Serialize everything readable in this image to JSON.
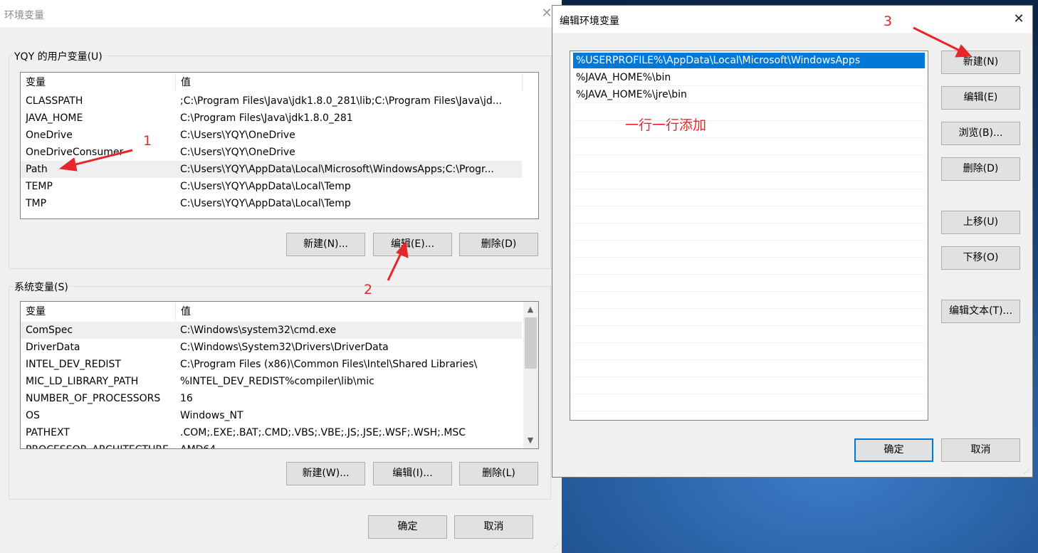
{
  "left_dialog": {
    "title": "环境变量",
    "user_group_label": "YQY 的用户变量(U)",
    "user_columns": [
      "变量",
      "值"
    ],
    "user_rows": [
      {
        "name": "CLASSPATH",
        "value": ";C:\\Program Files\\Java\\jdk1.8.0_281\\lib;C:\\Program Files\\Java\\jd..."
      },
      {
        "name": "JAVA_HOME",
        "value": "C:\\Program Files\\Java\\jdk1.8.0_281"
      },
      {
        "name": "OneDrive",
        "value": "C:\\Users\\YQY\\OneDrive"
      },
      {
        "name": "OneDriveConsumer",
        "value": "C:\\Users\\YQY\\OneDrive"
      },
      {
        "name": "Path",
        "value": "C:\\Users\\YQY\\AppData\\Local\\Microsoft\\WindowsApps;C:\\Progr..."
      },
      {
        "name": "TEMP",
        "value": "C:\\Users\\YQY\\AppData\\Local\\Temp"
      },
      {
        "name": "TMP",
        "value": "C:\\Users\\YQY\\AppData\\Local\\Temp"
      }
    ],
    "user_buttons": {
      "new": "新建(N)...",
      "edit": "编辑(E)...",
      "delete": "删除(D)"
    },
    "system_group_label": "系统变量(S)",
    "system_columns": [
      "变量",
      "值"
    ],
    "system_rows": [
      {
        "name": "ComSpec",
        "value": "C:\\Windows\\system32\\cmd.exe"
      },
      {
        "name": "DriverData",
        "value": "C:\\Windows\\System32\\Drivers\\DriverData"
      },
      {
        "name": "INTEL_DEV_REDIST",
        "value": "C:\\Program Files (x86)\\Common Files\\Intel\\Shared Libraries\\"
      },
      {
        "name": "MIC_LD_LIBRARY_PATH",
        "value": "%INTEL_DEV_REDIST%compiler\\lib\\mic"
      },
      {
        "name": "NUMBER_OF_PROCESSORS",
        "value": "16"
      },
      {
        "name": "OS",
        "value": "Windows_NT"
      },
      {
        "name": "PATHEXT",
        "value": ".COM;.EXE;.BAT;.CMD;.VBS;.VBE;.JS;.JSE;.WSF;.WSH;.MSC"
      },
      {
        "name": "PROCESSOR_ARCHITECTURE",
        "value": "AMD64"
      }
    ],
    "system_buttons": {
      "new": "新建(W)...",
      "edit": "编辑(I)...",
      "delete": "删除(L)"
    },
    "ok": "确定",
    "cancel": "取消"
  },
  "right_dialog": {
    "title": "编辑环境变量",
    "entries": [
      "%USERPROFILE%\\AppData\\Local\\Microsoft\\WindowsApps",
      "%JAVA_HOME%\\bin",
      "%JAVA_HOME%\\jre\\bin"
    ],
    "buttons": {
      "new": "新建(N)",
      "edit": "编辑(E)",
      "browse": "浏览(B)...",
      "delete": "删除(D)",
      "move_up": "上移(U)",
      "move_down": "下移(O)",
      "edit_text": "编辑文本(T)..."
    },
    "ok": "确定",
    "cancel": "取消"
  },
  "annotations": {
    "n1": "1",
    "n2": "2",
    "n3": "3",
    "note": "一行一行添加",
    "color": "#e8262a"
  },
  "icons": {
    "close": "close-icon",
    "scroll_up": "chevron-up-icon",
    "scroll_down": "chevron-down-icon",
    "grip": "resize-grip-icon"
  }
}
